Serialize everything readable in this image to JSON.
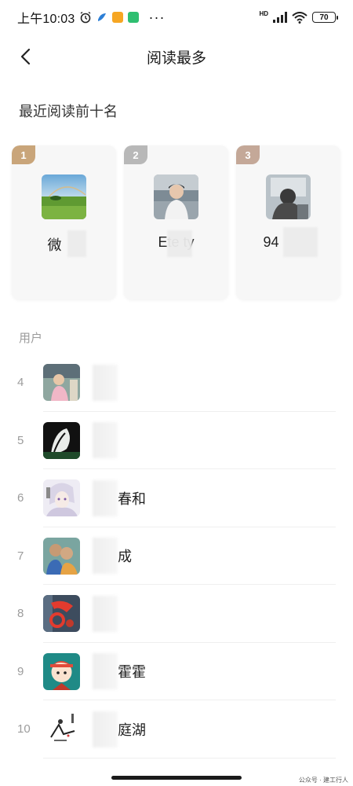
{
  "status_bar": {
    "time": "上午10:03",
    "more": "···",
    "hd": "HD",
    "battery": "70"
  },
  "header": {
    "title": "阅读最多",
    "back_icon": "chevron-left-icon"
  },
  "top_section": {
    "title": "最近阅读前十名",
    "cards": [
      {
        "rank": "1",
        "name": "微",
        "badge_color": "#c9a57a"
      },
      {
        "rank": "2",
        "name": "Ete    ty",
        "badge_color": "#b8b8b8"
      },
      {
        "rank": "3",
        "name": "94",
        "badge_color": "#c4a898"
      }
    ]
  },
  "users_section": {
    "label": "用户",
    "rows": [
      {
        "rank": "4",
        "name": ""
      },
      {
        "rank": "5",
        "name": ""
      },
      {
        "rank": "6",
        "name": "春和"
      },
      {
        "rank": "7",
        "name": "成"
      },
      {
        "rank": "8",
        "name": ""
      },
      {
        "rank": "9",
        "name": "霍霍"
      },
      {
        "rank": "10",
        "name": "庭湖"
      }
    ]
  },
  "watermark": "公众号 · 建工行人"
}
